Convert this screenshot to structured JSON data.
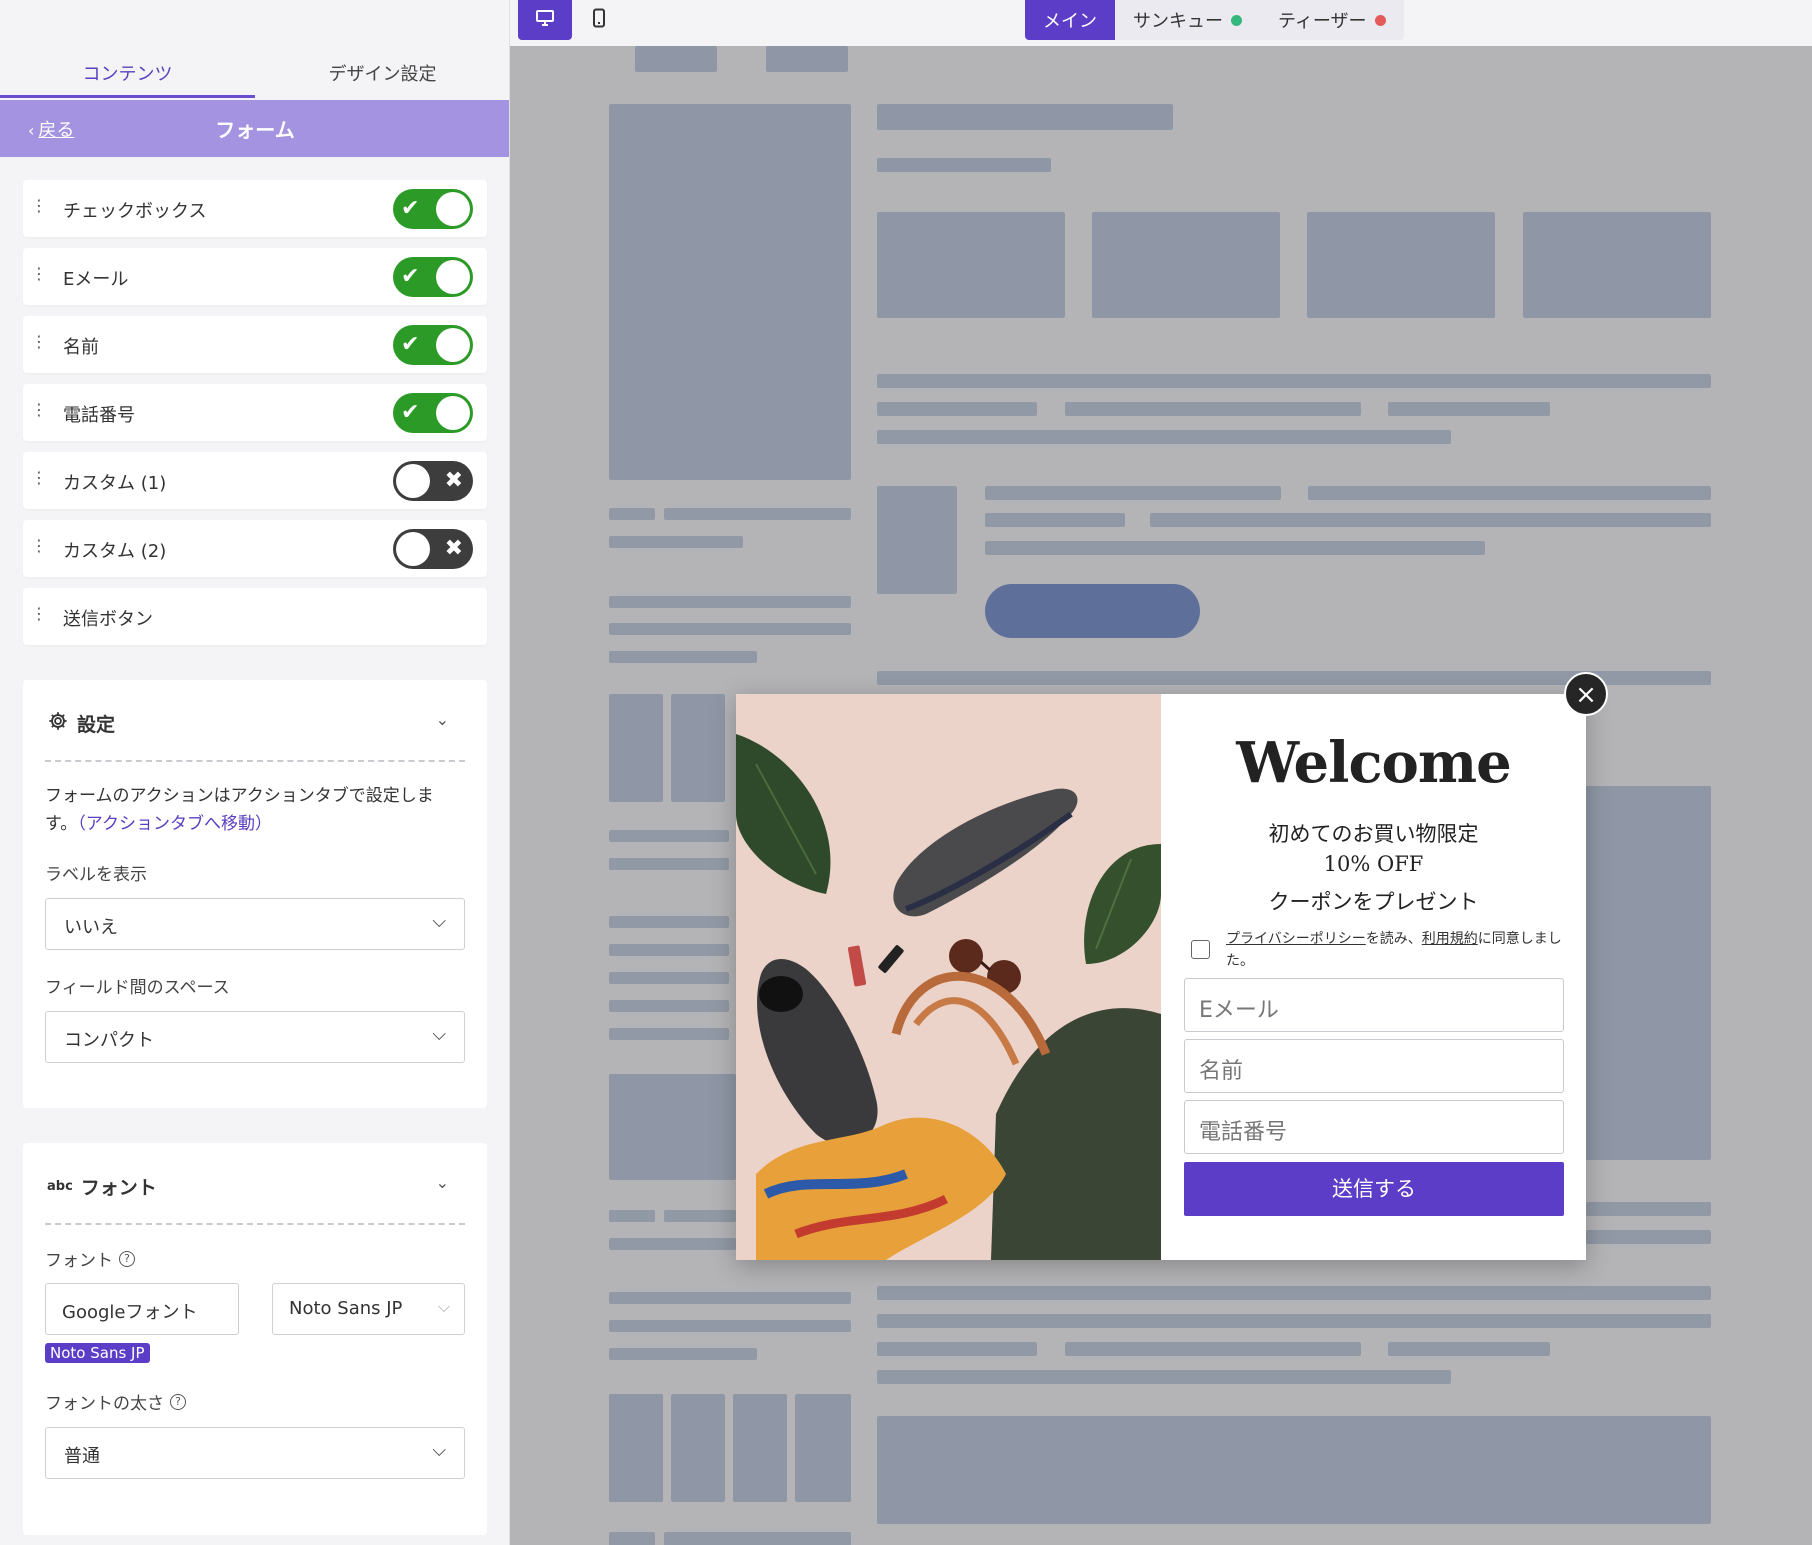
{
  "topbar": {
    "devices": [
      {
        "name": "desktop",
        "icon": "desktop-icon",
        "active": true
      },
      {
        "name": "mobile",
        "icon": "mobile-icon",
        "active": false
      }
    ],
    "views": [
      {
        "label": "メイン",
        "active": true
      },
      {
        "label": "サンキュー",
        "dot_color": "#35b77d"
      },
      {
        "label": "ティーザー",
        "dot_color": "#e35a5a"
      }
    ]
  },
  "panel": {
    "tabs": [
      {
        "label": "コンテンツ",
        "active": true
      },
      {
        "label": "デザイン設定"
      }
    ],
    "back_label": "戻る",
    "title": "フォーム",
    "fields": [
      {
        "label": "チェックボックス",
        "enabled": true
      },
      {
        "label": "Eメール",
        "enabled": true
      },
      {
        "label": "名前",
        "enabled": true
      },
      {
        "label": "電話番号",
        "enabled": true
      },
      {
        "label": "カスタム (1)",
        "enabled": false
      },
      {
        "label": "カスタム (2)",
        "enabled": false
      },
      {
        "label": "送信ボタン"
      }
    ],
    "settings": {
      "title": "設定",
      "note": "フォームのアクションはアクションタブで設定します。",
      "note_link": "（アクションタブへ移動）",
      "show_label": {
        "label": "ラベルを表示",
        "value": "いいえ"
      },
      "spacing": {
        "label": "フィールド間のスペース",
        "value": "コンパクト"
      }
    },
    "font": {
      "title": "フォント",
      "font_label": "フォント",
      "source": "Googleフォント",
      "family": "Noto Sans JP",
      "chip": "Noto Sans JP",
      "weight": {
        "label": "フォントの太さ",
        "value": "普通"
      }
    }
  },
  "popup": {
    "title": "Welcome",
    "lines": [
      "初めてのお買い物限定",
      "10% OFF",
      "クーポンをプレゼント"
    ],
    "consent": {
      "privacy": "プライバシーポリシー",
      "mid": "を読み、",
      "terms": "利用規約",
      "end": "に同意しました。"
    },
    "fields": {
      "email": "Eメール",
      "name": "名前",
      "phone": "電話番号"
    },
    "submit": "送信する",
    "close": "×"
  },
  "colors": {
    "accent": "#5b3dc7",
    "toggle_on": "#2b9a26",
    "toggle_off": "#3d3d3d",
    "header": "#a393e0"
  }
}
